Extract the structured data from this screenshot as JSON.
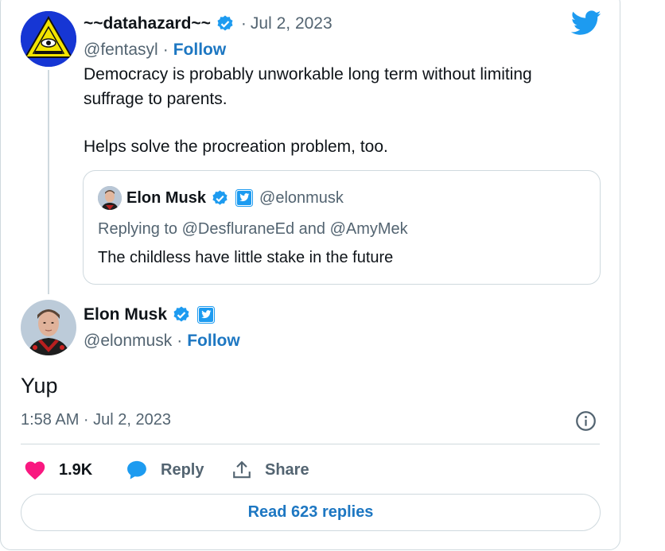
{
  "parent_tweet": {
    "display_name": "~~datahazard~~",
    "handle": "@fentasyl",
    "separator": "·",
    "date": "Jul 2, 2023",
    "follow_label": "Follow",
    "text_line1": "Democracy is probably unworkable long term without limiting",
    "text_line2": "suffrage to parents.",
    "text_line3": "Helps solve the procreation problem, too."
  },
  "quoted_tweet": {
    "display_name": "Elon Musk",
    "handle": "@elonmusk",
    "replying_to": "Replying to @DesfluraneEd and @AmyMek",
    "text": "The childless have little stake in the future"
  },
  "main_tweet": {
    "display_name": "Elon Musk",
    "handle": "@elonmusk",
    "separator": "·",
    "follow_label": "Follow",
    "text": "Yup",
    "timestamp": "1:58 AM · Jul 2, 2023"
  },
  "actions": {
    "like_count": "1.9K",
    "reply_label": "Reply",
    "share_label": "Share"
  },
  "read_replies_label": "Read 623 replies",
  "icons": {
    "brand": "twitter-bird-icon",
    "verified": "verified-badge-icon",
    "affiliate": "twitter-affiliate-icon",
    "info": "info-icon",
    "like": "heart-icon",
    "reply": "speech-bubble-icon",
    "share": "share-upload-icon"
  },
  "colors": {
    "brand_blue": "#1d9bf0",
    "link_blue": "#1d77c2",
    "like_pink": "#f91880",
    "muted_text": "#536471",
    "border": "#cfd9de"
  }
}
